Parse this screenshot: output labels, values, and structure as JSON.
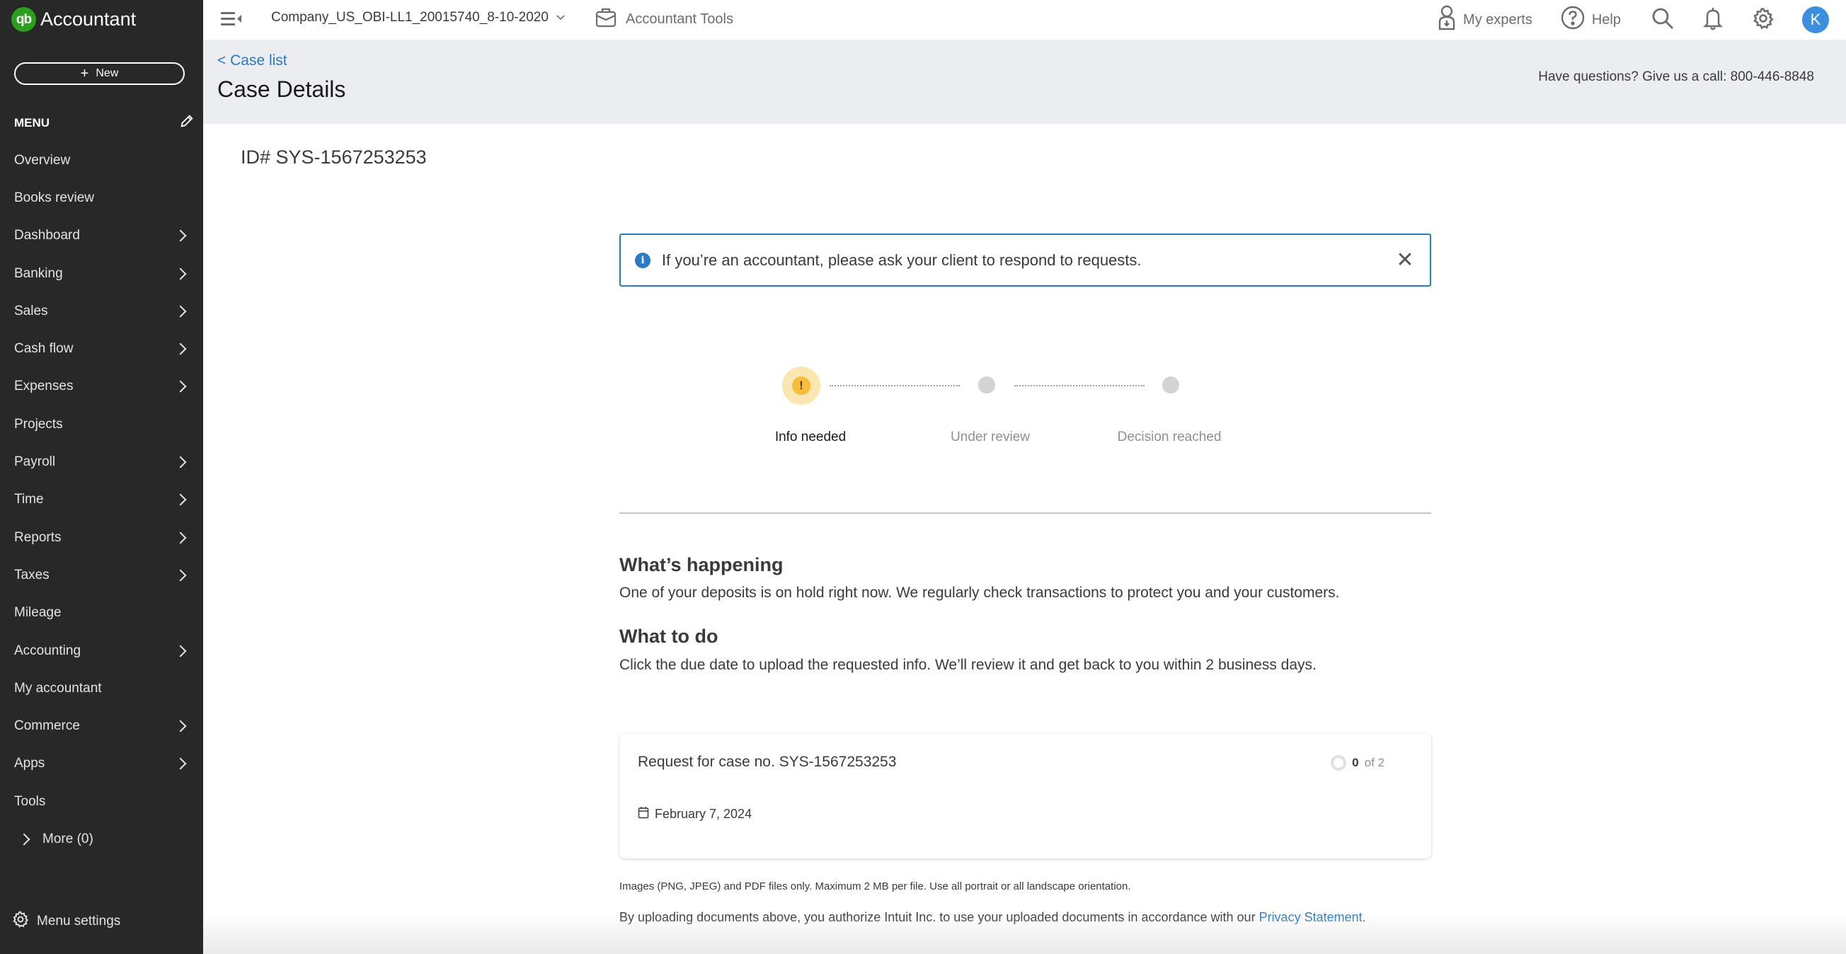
{
  "app": {
    "brand_badge": "qb",
    "brand_name": "Accountant",
    "new_button": "New"
  },
  "sidebar": {
    "menu_heading": "MENU",
    "items": [
      {
        "label": "Overview",
        "has_submenu": false
      },
      {
        "label": "Books review",
        "has_submenu": false
      },
      {
        "label": "Dashboard",
        "has_submenu": true
      },
      {
        "label": "Banking",
        "has_submenu": true
      },
      {
        "label": "Sales",
        "has_submenu": true
      },
      {
        "label": "Cash flow",
        "has_submenu": true
      },
      {
        "label": "Expenses",
        "has_submenu": true
      },
      {
        "label": "Projects",
        "has_submenu": false
      },
      {
        "label": "Payroll",
        "has_submenu": true
      },
      {
        "label": "Time",
        "has_submenu": true
      },
      {
        "label": "Reports",
        "has_submenu": true
      },
      {
        "label": "Taxes",
        "has_submenu": true
      },
      {
        "label": "Mileage",
        "has_submenu": false
      },
      {
        "label": "Accounting",
        "has_submenu": true
      },
      {
        "label": "My accountant",
        "has_submenu": false
      },
      {
        "label": "Commerce",
        "has_submenu": true
      },
      {
        "label": "Apps",
        "has_submenu": true
      },
      {
        "label": "Tools",
        "has_submenu": false
      }
    ],
    "more_label": "More (0)",
    "menu_settings": "Menu settings"
  },
  "topbar": {
    "company_name": "Company_US_OBI-LL1_20015740_8-10-2020",
    "accountant_tools": "Accountant Tools",
    "my_experts": "My experts",
    "help": "Help",
    "avatar_initial": "K"
  },
  "header": {
    "back_link": "< Case list",
    "title": "Case Details",
    "call_line": "Have questions? Give us a call: 800-446-8848"
  },
  "case": {
    "id_label": "ID# SYS-1567253253",
    "banner_message": "If you’re an accountant, please ask your client to respond to requests.",
    "banner_close": "✕",
    "steps": [
      {
        "label": "Info needed",
        "state": "active",
        "glyph": "!"
      },
      {
        "label": "Under review",
        "state": "pending"
      },
      {
        "label": "Decision reached",
        "state": "pending"
      }
    ],
    "whats_happening_title": "What’s happening",
    "whats_happening_body": "One of your deposits is on hold right now. We regularly check transactions to protect you and your customers.",
    "what_to_do_title": "What to do",
    "what_to_do_body": "Click the due date to upload the requested info. We’ll review it and get back to you within 2 business days.",
    "request": {
      "title": "Request for case no. SYS-1567253253",
      "completed": "0",
      "total_text": "of 2",
      "due_date": "February 7, 2024"
    },
    "file_note": "Images (PNG, JPEG) and PDF files only. Maximum 2 MB per file. Use all portrait or all landscape orientation.",
    "authorization_text": "By uploading documents above, you authorize Intuit Inc. to use your uploaded documents in accordance with our ",
    "privacy_link": "Privacy Statement."
  },
  "colors": {
    "sidebar_bg": "#282828",
    "brand_green": "#2ca01c",
    "link_blue": "#2b7bc4",
    "header_bg": "#ecedf1",
    "step_active": "#f5bd3a",
    "avatar_blue": "#3c8fde"
  }
}
